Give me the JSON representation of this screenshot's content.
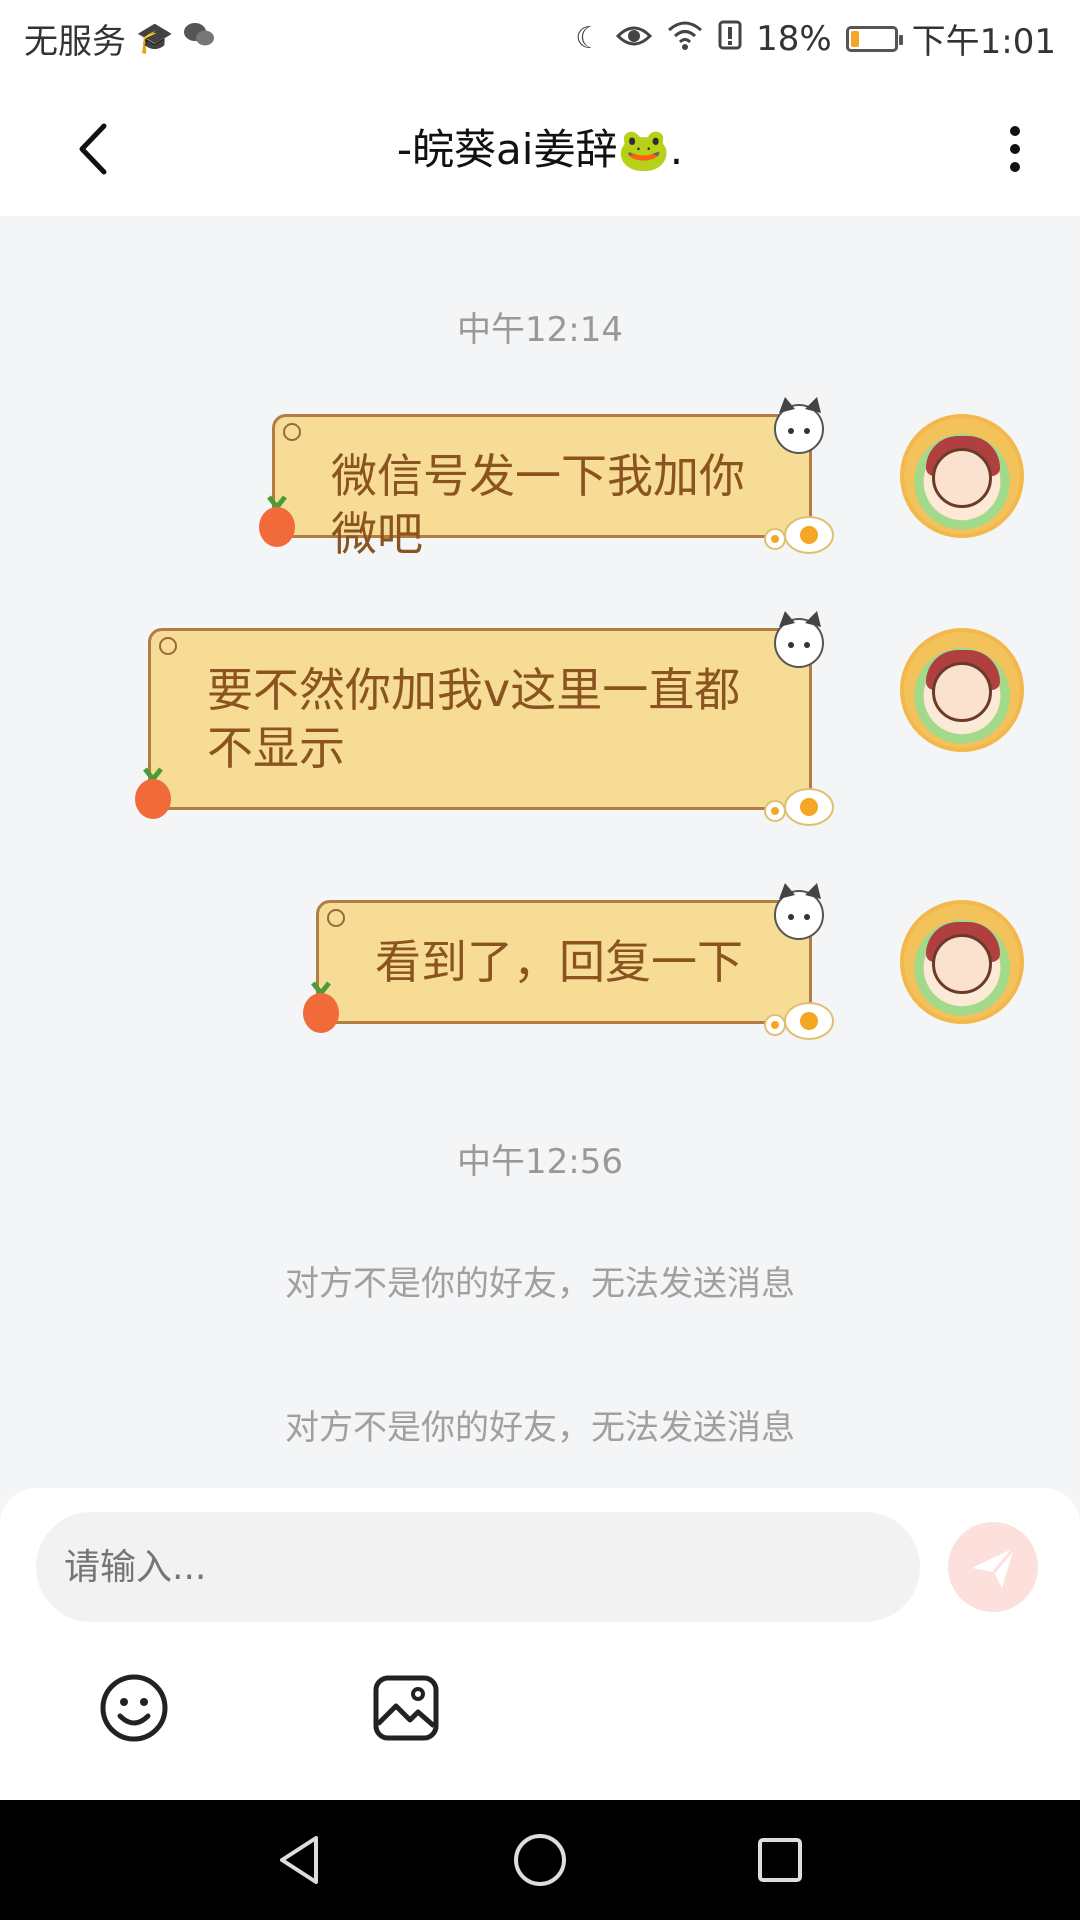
{
  "status_bar": {
    "carrier": "无服务",
    "battery_percent": "18%",
    "battery_level": 0.18,
    "time": "下午1:01",
    "icons": [
      "graduation-cap-icon",
      "wechat-icon",
      "moon-icon",
      "eye-icon",
      "wifi-icon",
      "battery-alert-icon",
      "battery-icon"
    ]
  },
  "header": {
    "title": "-皖葵ai姜辞🐸."
  },
  "messages": {
    "timestamp_1": "中午12:14",
    "msg_1": "微信号发一下我加你微吧",
    "msg_2_line1": "要不然你加我v这里一直都",
    "msg_2_line2": "不显示",
    "msg_3": "看到了，回复一下",
    "timestamp_2": "中午12:56",
    "system_1": "对方不是你的好友，无法发送消息",
    "system_2": "对方不是你的好友，无法发送消息"
  },
  "input": {
    "placeholder": "请输入..."
  },
  "colors": {
    "bubble_bg": "#f6dc94",
    "bubble_border": "#b27c44",
    "bubble_text": "#8a5320",
    "chat_bg": "#f4f5f7",
    "send_button": "#fde0dc"
  }
}
